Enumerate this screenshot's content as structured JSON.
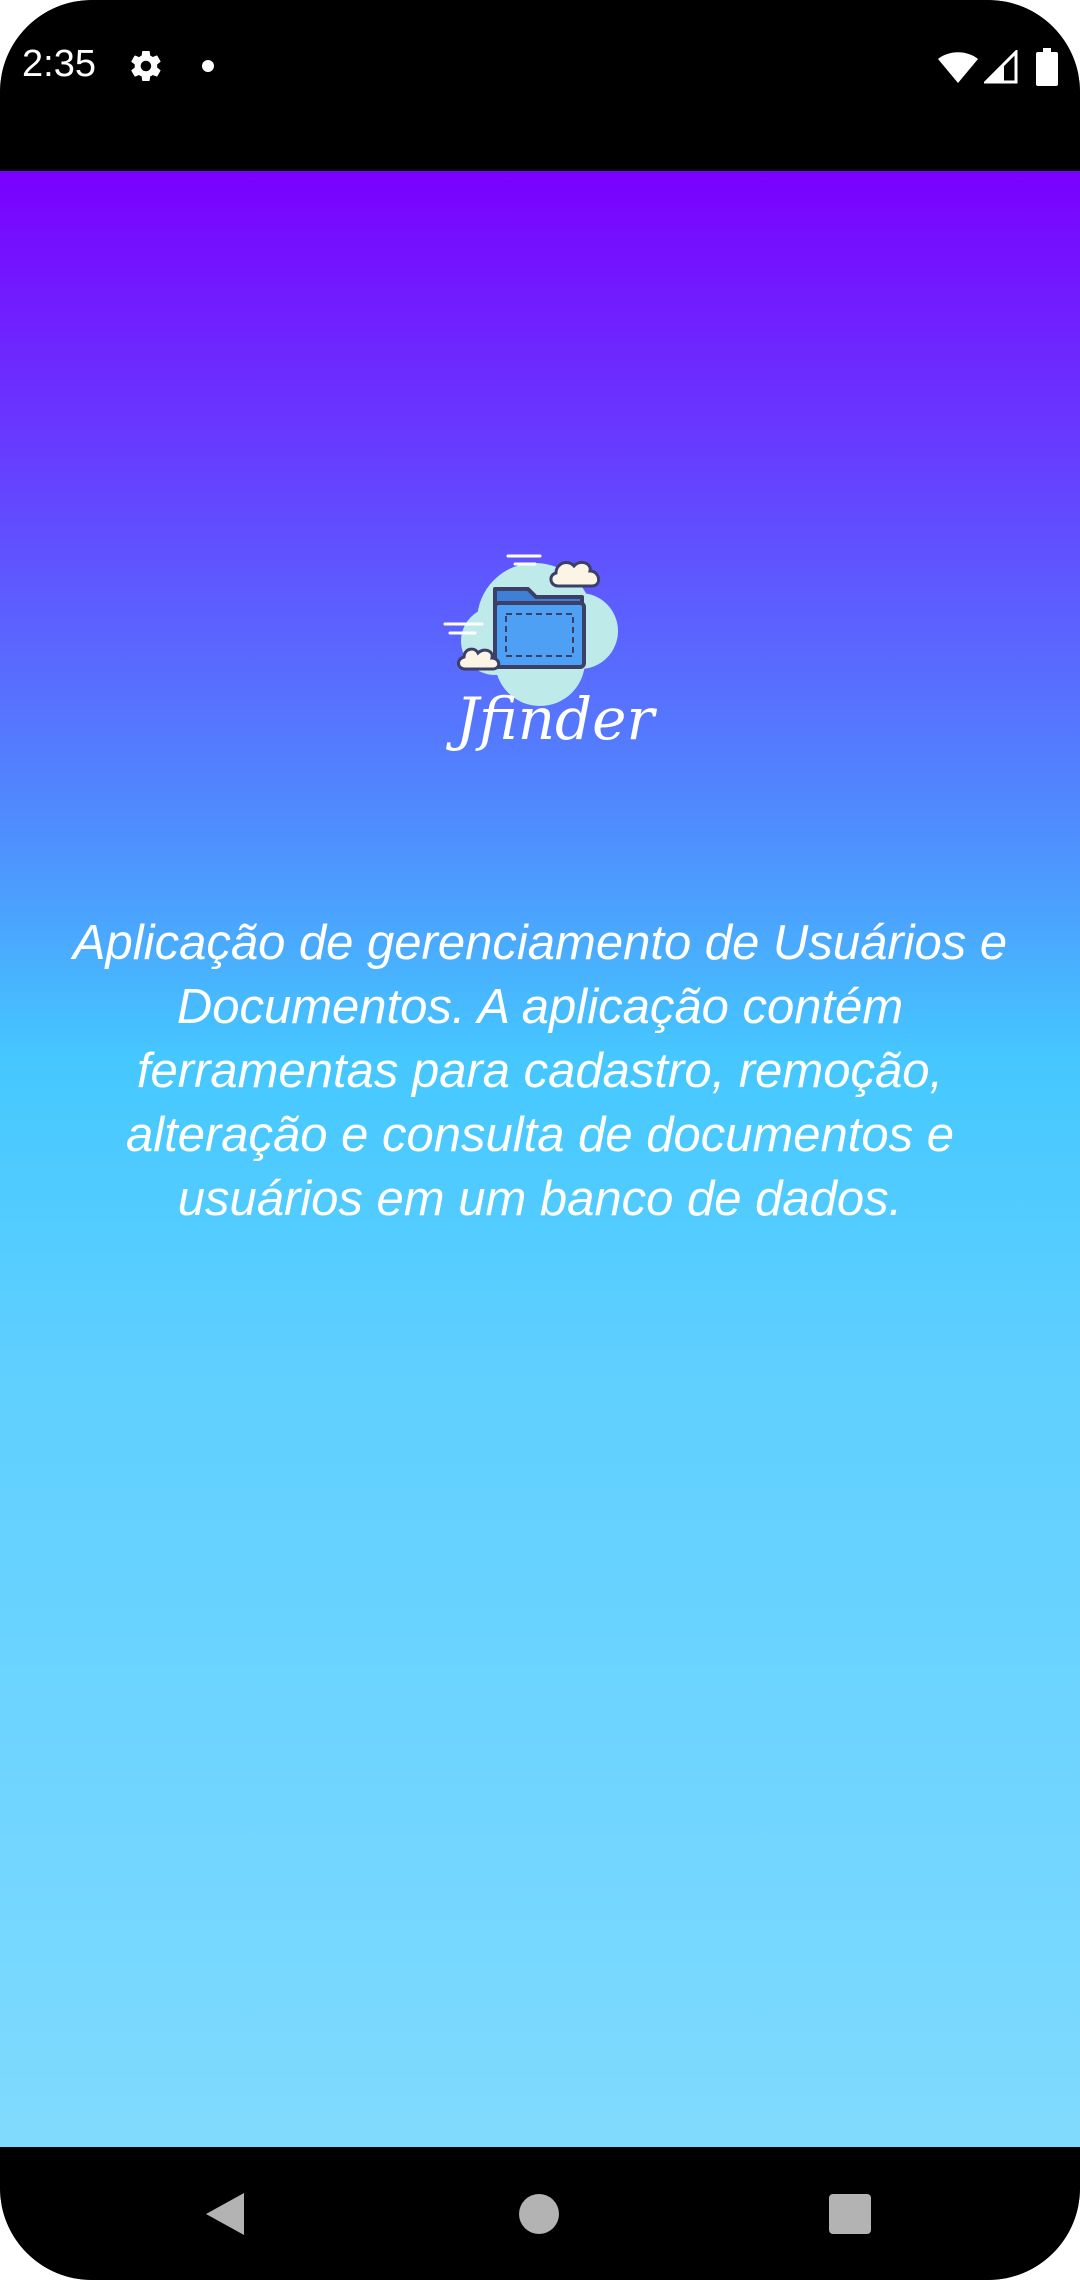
{
  "status_bar": {
    "time": "2:35",
    "icons": [
      "gear-icon",
      "notification-dot-icon",
      "wifi-icon",
      "cell-signal-icon",
      "battery-icon"
    ]
  },
  "app": {
    "logo_icon": "folder-cloud-icon",
    "name": "Jfinder",
    "description": "Aplicação de gerenciamento de Usuários e Documentos. A aplicação contém ferramentas para cadastro, remoção, alteração e consulta de documentos e usuários em um banco de dados.",
    "colors": {
      "gradient_top": "#7a00ff",
      "gradient_middle": "#45c8ff",
      "gradient_bottom": "#80dafe",
      "text": "#ffffff"
    }
  },
  "nav_bar": {
    "icons": [
      "back-icon",
      "home-icon",
      "recents-icon"
    ]
  }
}
